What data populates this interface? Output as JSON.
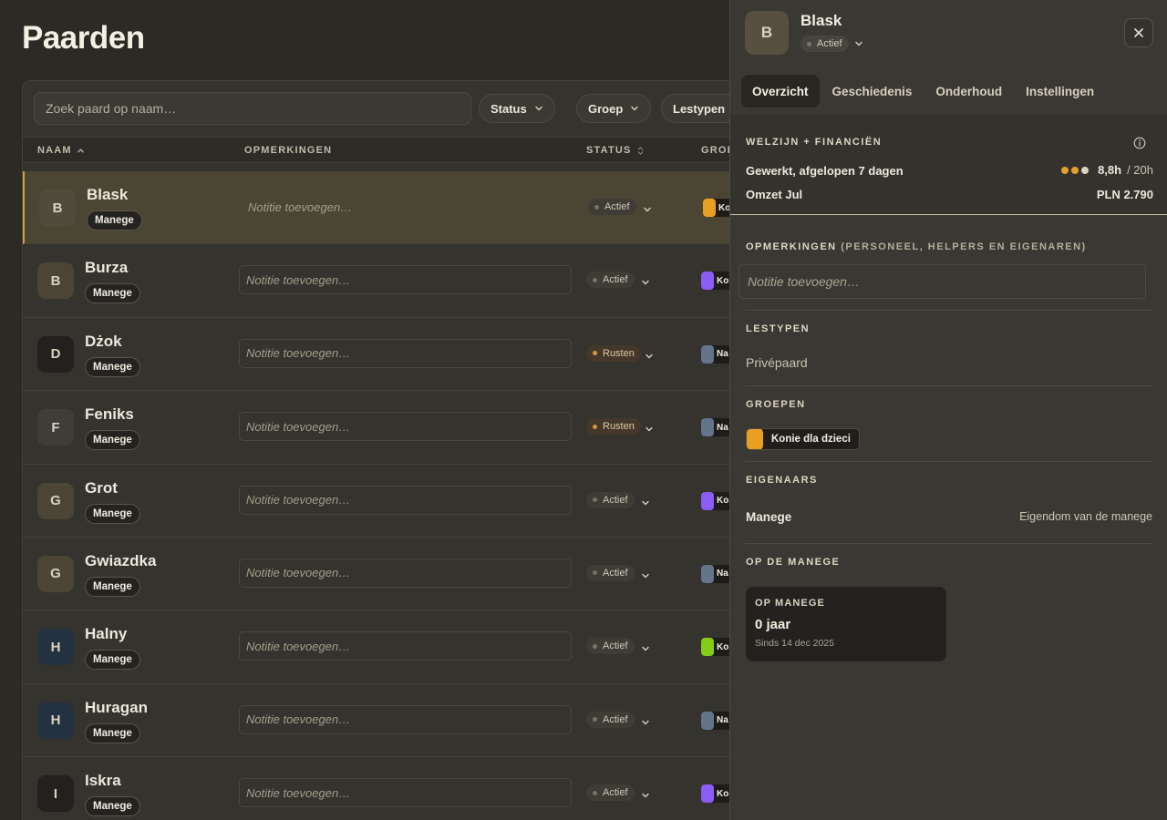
{
  "page": {
    "title": "Paarden"
  },
  "toolbar": {
    "search_placeholder": "Zoek paard op naam…",
    "filters": [
      "Status",
      "Groep",
      "Lestypen"
    ]
  },
  "table": {
    "columns": {
      "name": "NAAM",
      "notes": "OPMERKINGEN",
      "status": "STATUS",
      "group": "GROEP"
    },
    "rows": [
      {
        "initial": "B",
        "name": "Blask",
        "badge": "Manege",
        "note_placeholder": "Notitie toevoegen…",
        "status": "Actief",
        "status_type": "active",
        "group_color": "#e9a021",
        "group_label": "Ko",
        "avatar_bg": "#514b3b",
        "selected": true
      },
      {
        "initial": "B",
        "name": "Burza",
        "badge": "Manege",
        "note_placeholder": "Notitie toevoegen…",
        "status": "Actief",
        "status_type": "active",
        "group_color": "#8b5cf6",
        "group_label": "Ko",
        "avatar_bg": "#4a4535",
        "selected": false
      },
      {
        "initial": "D",
        "name": "Dżok",
        "badge": "Manege",
        "note_placeholder": "Notitie toevoegen…",
        "status": "Rusten",
        "status_type": "rest",
        "group_color": "#64748b",
        "group_label": "Na",
        "avatar_bg": "#22211d",
        "selected": false
      },
      {
        "initial": "F",
        "name": "Feniks",
        "badge": "Manege",
        "note_placeholder": "Notitie toevoegen…",
        "status": "Rusten",
        "status_type": "rest",
        "group_color": "#64748b",
        "group_label": "Na",
        "avatar_bg": "#3f3d37",
        "selected": false
      },
      {
        "initial": "G",
        "name": "Grot",
        "badge": "Manege",
        "note_placeholder": "Notitie toevoegen…",
        "status": "Actief",
        "status_type": "active",
        "group_color": "#8b5cf6",
        "group_label": "Ko",
        "avatar_bg": "#4a4535",
        "selected": false
      },
      {
        "initial": "G",
        "name": "Gwiazdka",
        "badge": "Manege",
        "note_placeholder": "Notitie toevoegen…",
        "status": "Actief",
        "status_type": "active",
        "group_color": "#64748b",
        "group_label": "Na",
        "avatar_bg": "#4a4535",
        "selected": false
      },
      {
        "initial": "H",
        "name": "Halny",
        "badge": "Manege",
        "note_placeholder": "Notitie toevoegen…",
        "status": "Actief",
        "status_type": "active",
        "group_color": "#84cc16",
        "group_label": "Ko",
        "avatar_bg": "#243140",
        "selected": false
      },
      {
        "initial": "H",
        "name": "Huragan",
        "badge": "Manege",
        "note_placeholder": "Notitie toevoegen…",
        "status": "Actief",
        "status_type": "active",
        "group_color": "#64748b",
        "group_label": "Na",
        "avatar_bg": "#243140",
        "selected": false
      },
      {
        "initial": "I",
        "name": "Iskra",
        "badge": "Manege",
        "note_placeholder": "Notitie toevoegen…",
        "status": "Actief",
        "status_type": "active",
        "group_color": "#8b5cf6",
        "group_label": "Ko",
        "avatar_bg": "#22211d",
        "selected": false
      }
    ]
  },
  "drawer": {
    "initial": "B",
    "name": "Blask",
    "status": "Actief",
    "tabs": [
      "Overzicht",
      "Geschiedenis",
      "Onderhoud",
      "Instellingen"
    ],
    "active_tab": "Overzicht",
    "summary": {
      "title": "WELZIJN + FINANCIËN",
      "worked_label": "Gewerkt, afgelopen 7 dagen",
      "worked_value": "8,8h",
      "worked_limit": "/ 20h",
      "worked_dots": [
        "#e3a02a",
        "#e3a02a",
        "#d9d3c4"
      ],
      "revenue_label": "Omzet Jul",
      "revenue_value": "PLN 2.790"
    },
    "notes": {
      "title": "OPMERKINGEN",
      "subtitle": "(PERSONEEL, HELPERS EN EIGENAREN)",
      "placeholder": "Notitie toevoegen…"
    },
    "lesson_types": {
      "title": "LESTYPEN",
      "value": "Privépaard"
    },
    "groups": {
      "title": "GROEPEN",
      "items": [
        {
          "label": "Konie dla dzieci",
          "color": "#e9a021"
        }
      ]
    },
    "owners": {
      "title": "EIGENAARS",
      "name": "Manege",
      "type": "Eigendom van de manege"
    },
    "at_stable": {
      "title": "OP DE MANEGE",
      "card_label": "OP MANEGE",
      "card_value": "0 jaar",
      "card_since": "Sinds 14 dec 2025"
    },
    "colors": {
      "accent": "#c9a24a",
      "selected_row": "#4b4634"
    }
  }
}
